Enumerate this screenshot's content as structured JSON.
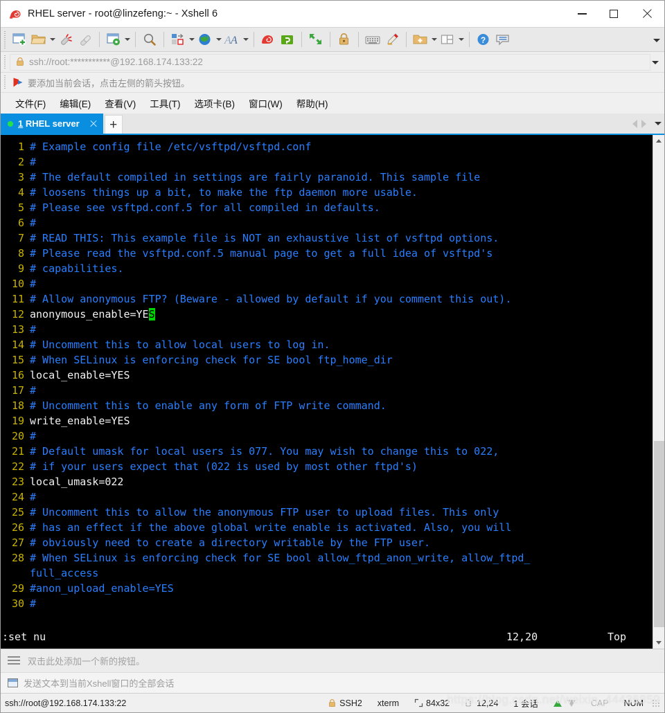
{
  "window": {
    "title": "RHEL server - root@linzefeng:~ - Xshell 6",
    "app_icon": "snail-icon",
    "controls": {
      "minimize": "minimize-button",
      "maximize": "maximize-button",
      "close": "close-button"
    }
  },
  "toolbar": {
    "items": [
      {
        "name": "new-session-icon",
        "has_caret": false
      },
      {
        "name": "open-folder-icon",
        "has_caret": true
      },
      {
        "name": "disconnect-icon",
        "has_caret": false
      },
      {
        "name": "reconnect-icon",
        "has_caret": false
      },
      {
        "sep": true
      },
      {
        "name": "session-properties-icon",
        "has_caret": true
      },
      {
        "sep": true
      },
      {
        "name": "find-icon",
        "has_caret": false
      },
      {
        "sep": true
      },
      {
        "name": "layout-icon",
        "has_caret": true
      },
      {
        "name": "globe-icon",
        "has_caret": true
      },
      {
        "name": "font-icon",
        "has_caret": true
      },
      {
        "sep": true
      },
      {
        "name": "xshell-icon",
        "has_caret": false
      },
      {
        "name": "xftp-icon",
        "has_caret": false
      },
      {
        "sep": true
      },
      {
        "name": "fullscreen-icon",
        "has_caret": false
      },
      {
        "sep": true
      },
      {
        "name": "lock-icon",
        "has_caret": false
      },
      {
        "sep": true
      },
      {
        "name": "keyboard-icon",
        "has_caret": false
      },
      {
        "name": "highlight-pen-icon",
        "has_caret": false
      },
      {
        "sep": true
      },
      {
        "name": "add-to-folder-icon",
        "has_caret": true
      },
      {
        "name": "arrange-panes-icon",
        "has_caret": true
      },
      {
        "sep": true
      },
      {
        "name": "help-icon",
        "has_caret": false
      },
      {
        "name": "chat-icon",
        "has_caret": false
      }
    ],
    "overflow": "toolbar-overflow-icon"
  },
  "address_bar": {
    "icon": "lock-icon",
    "value": "ssh://root:***********@192.168.174.133:22",
    "dropdown": "address-dropdown-icon"
  },
  "hint_bar": {
    "icon": "red-arrow-flag-icon",
    "text": "要添加当前会话，点击左侧的箭头按钮。"
  },
  "menu": {
    "items": [
      "文件(F)",
      "编辑(E)",
      "查看(V)",
      "工具(T)",
      "选项卡(B)",
      "窗口(W)",
      "帮助(H)"
    ]
  },
  "tabs": {
    "active": {
      "index": "1",
      "label": "RHEL server",
      "status": "connected",
      "close": "×"
    },
    "add_label": "+",
    "nav": {
      "left": "tab-scroll-left-icon",
      "right": "tab-scroll-right-icon",
      "list": "tab-list-icon"
    }
  },
  "terminal": {
    "colors": {
      "background": "#000000",
      "comment": "#2a7fff",
      "text": "#f2f2f2",
      "linenumber": "#c8b400",
      "cursor": "#00d400"
    },
    "lines": [
      {
        "n": "1",
        "segments": [
          {
            "t": "# Example config file /etc/vsftpd/vsftpd.conf",
            "c": "cmt"
          }
        ]
      },
      {
        "n": "2",
        "segments": [
          {
            "t": "#",
            "c": "cmt"
          }
        ]
      },
      {
        "n": "3",
        "segments": [
          {
            "t": "# The default compiled in settings are fairly paranoid. This sample file",
            "c": "cmt"
          }
        ]
      },
      {
        "n": "4",
        "segments": [
          {
            "t": "# loosens things up a bit, to make the ftp daemon more usable.",
            "c": "cmt"
          }
        ]
      },
      {
        "n": "5",
        "segments": [
          {
            "t": "# Please see vsftpd.conf.5 for all compiled in defaults.",
            "c": "cmt"
          }
        ]
      },
      {
        "n": "6",
        "segments": [
          {
            "t": "#",
            "c": "cmt"
          }
        ]
      },
      {
        "n": "7",
        "segments": [
          {
            "t": "# READ THIS: This example file is NOT an exhaustive list of vsftpd options.",
            "c": "cmt"
          }
        ]
      },
      {
        "n": "8",
        "segments": [
          {
            "t": "# Please read the vsftpd.conf.5 manual page to get a full idea of vsftpd's",
            "c": "cmt"
          }
        ]
      },
      {
        "n": "9",
        "segments": [
          {
            "t": "# capabilities.",
            "c": "cmt"
          }
        ]
      },
      {
        "n": "10",
        "segments": [
          {
            "t": "#",
            "c": "cmt"
          }
        ]
      },
      {
        "n": "11",
        "segments": [
          {
            "t": "# Allow anonymous FTP? (Beware - allowed by default if you comment this out).",
            "c": "cmt"
          }
        ]
      },
      {
        "n": "12",
        "segments": [
          {
            "t": "anonymous_enable=YE",
            "c": "txt"
          },
          {
            "t": "S",
            "c": "cursor"
          }
        ]
      },
      {
        "n": "13",
        "segments": [
          {
            "t": "#",
            "c": "cmt"
          }
        ]
      },
      {
        "n": "14",
        "segments": [
          {
            "t": "# Uncomment this to allow local users to log in.",
            "c": "cmt"
          }
        ]
      },
      {
        "n": "15",
        "segments": [
          {
            "t": "# When SELinux is enforcing check for SE bool ftp_home_dir",
            "c": "cmt"
          }
        ]
      },
      {
        "n": "16",
        "segments": [
          {
            "t": "local_enable=YES",
            "c": "txt"
          }
        ]
      },
      {
        "n": "17",
        "segments": [
          {
            "t": "#",
            "c": "cmt"
          }
        ]
      },
      {
        "n": "18",
        "segments": [
          {
            "t": "# Uncomment this to enable any form of FTP write command.",
            "c": "cmt"
          }
        ]
      },
      {
        "n": "19",
        "segments": [
          {
            "t": "write_enable=YES",
            "c": "txt"
          }
        ]
      },
      {
        "n": "20",
        "segments": [
          {
            "t": "#",
            "c": "cmt"
          }
        ]
      },
      {
        "n": "21",
        "segments": [
          {
            "t": "# Default umask for local users is 077. You may wish to change this to 022,",
            "c": "cmt"
          }
        ]
      },
      {
        "n": "22",
        "segments": [
          {
            "t": "# if your users expect that (022 is used by most other ftpd's)",
            "c": "cmt"
          }
        ]
      },
      {
        "n": "23",
        "segments": [
          {
            "t": "local_umask=022",
            "c": "txt"
          }
        ]
      },
      {
        "n": "24",
        "segments": [
          {
            "t": "#",
            "c": "cmt"
          }
        ]
      },
      {
        "n": "25",
        "segments": [
          {
            "t": "# Uncomment this to allow the anonymous FTP user to upload files. This only",
            "c": "cmt"
          }
        ]
      },
      {
        "n": "26",
        "segments": [
          {
            "t": "# has an effect if the above global write enable is activated. Also, you will",
            "c": "cmt"
          }
        ]
      },
      {
        "n": "27",
        "segments": [
          {
            "t": "# obviously need to create a directory writable by the FTP user.",
            "c": "cmt"
          }
        ]
      },
      {
        "n": "28",
        "segments": [
          {
            "t": "# When SELinux is enforcing check for SE bool allow_ftpd_anon_write, allow_ftpd_",
            "c": "cmt"
          }
        ]
      },
      {
        "n": "",
        "segments": [
          {
            "t": "full_access",
            "c": "cmt"
          }
        ]
      },
      {
        "n": "29",
        "segments": [
          {
            "t": "#anon_upload_enable=YES",
            "c": "cmt"
          }
        ]
      },
      {
        "n": "30",
        "segments": [
          {
            "t": "#",
            "c": "cmt"
          }
        ]
      }
    ],
    "status": {
      "command": ":set nu",
      "position": "12,20",
      "location": "Top"
    },
    "scrollbar": {
      "up": "scroll-up-icon",
      "down": "scroll-down-icon"
    }
  },
  "quick_button_bar": {
    "icon": "hamburger-icon",
    "text": "双击此处添加一个新的按钮。"
  },
  "send_bar": {
    "icon": "send-to-all-sessions-icon",
    "text": "发送文本到当前Xshell窗口的全部会话"
  },
  "status_bar": {
    "connection": "ssh://root@192.168.174.133:22",
    "lock_icon": "lock-icon",
    "protocol": "SSH2",
    "terminal_type": "xterm",
    "size_icon": "screen-size-icon",
    "size": "84x32",
    "cursor_icon": "cursor-position-icon",
    "cursor": "12,24",
    "sessions": "1 会话",
    "transfer_up": "upload-arrow-icon",
    "transfer_down": "download-arrow-icon",
    "caps": "CAP",
    "num": "NUM",
    "grip": "resize-grip-icon",
    "watermark": "https://blog.csdn.net/weixin_44436859"
  }
}
